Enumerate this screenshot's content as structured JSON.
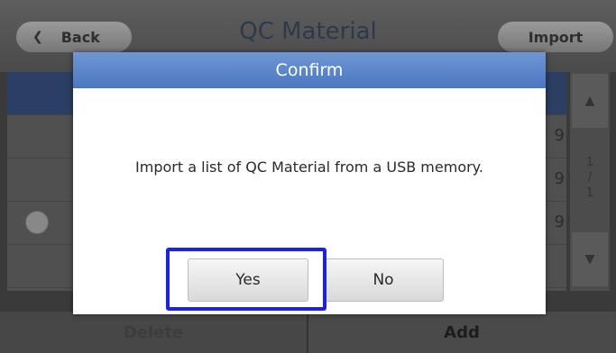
{
  "header": {
    "back_label": "Back",
    "back_icon": "chevron-left-icon",
    "title": "QC Material",
    "import_label": "Import"
  },
  "list": {
    "rows": [
      {
        "num": "",
        "selected": true,
        "radio": false
      },
      {
        "num": "9",
        "selected": false,
        "radio": false
      },
      {
        "num": "9",
        "selected": false,
        "radio": false
      },
      {
        "num": "9",
        "selected": false,
        "radio": true
      },
      {
        "num": "",
        "selected": false,
        "radio": false
      }
    ]
  },
  "scroll": {
    "up_icon": "triangle-up-icon",
    "down_icon": "triangle-down-icon",
    "page_current": "1",
    "page_sep": "/",
    "page_total": "1"
  },
  "footer": {
    "delete_label": "Delete",
    "add_label": "Add"
  },
  "dialog": {
    "title": "Confirm",
    "message": "Import a list of QC Material from a USB memory.",
    "yes_label": "Yes",
    "no_label": "No",
    "header_color": "#4b77bf",
    "highlight_color": "#1a22e6"
  }
}
